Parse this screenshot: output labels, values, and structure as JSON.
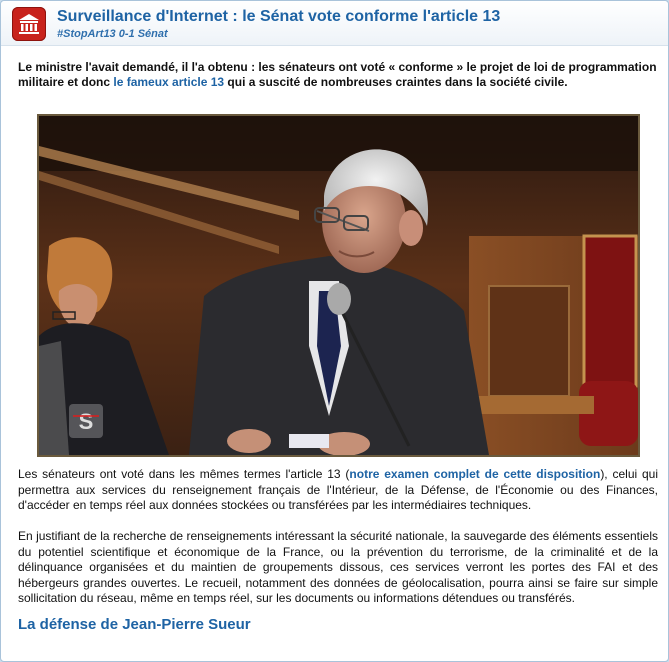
{
  "article": {
    "title": "Surveillance d'Internet : le Sénat vote conforme l'article 13",
    "subtitle": "#StopArt13 0-1 Sénat",
    "lead": {
      "before_link": "Le ministre l'avait demandé, il l'a obtenu : les sénateurs ont voté « conforme » le projet de loi de programmation militaire et donc ",
      "link": "le fameux article 13",
      "after_link": " qui a suscité de nombreuses craintes dans la société civile."
    },
    "paragraph1": {
      "before_link": "Les sénateurs ont voté dans les mêmes termes l'article 13 (",
      "link": "notre examen complet de cette disposition",
      "after_link": "), celui qui permettra aux services du renseignement français de l'Intérieur, de la Défense, de l'Économie ou des Finances, d'accéder en temps réel aux données stockées ou transférées par les intermédiaires techniques."
    },
    "paragraph2": "En justifiant de la recherche de renseignements intéressant la sécurité nationale, la sauvegarde des éléments essentiels du potentiel scientifique et économique de la France, ou la prévention du terrorisme, de la criminalité et de la délinquance organisées et du maintien de groupements dissous, ces services verront les portes des FAI et des hébergeurs grandes ouvertes. Le recueil, notamment des données de géolocalisation, pourra ainsi se faire sur simple sollicitation du réseau, même en temps réel, sur les documents ou informations détendues ou transférés.",
    "section_heading": "La défense de Jean-Pierre Sueur"
  },
  "icons": {
    "site_logo": "senate-building-icon",
    "video_watermark": "public-senat-logo-icon"
  },
  "colors": {
    "accent": "#1e63a4",
    "logo_red": "#c8231c"
  }
}
